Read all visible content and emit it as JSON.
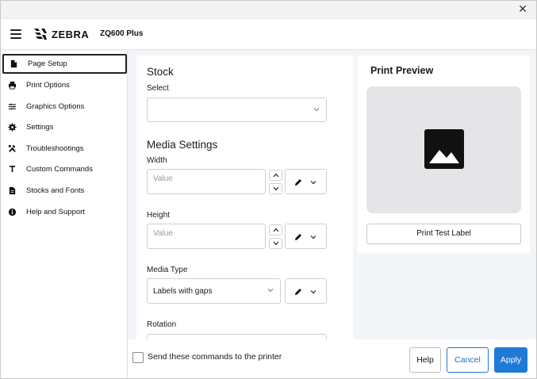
{
  "app": {
    "logo_text": "ZEBRA",
    "device_name": "ZQ600 Plus"
  },
  "sidebar": {
    "items": [
      {
        "label": "Page Setup",
        "icon": "document-icon",
        "active": true
      },
      {
        "label": "Print Options",
        "icon": "printer-icon",
        "active": false
      },
      {
        "label": "Graphics Options",
        "icon": "sliders-icon",
        "active": false
      },
      {
        "label": "Settings",
        "icon": "gear-icon",
        "active": false
      },
      {
        "label": "Troubleshootings",
        "icon": "tools-icon",
        "active": false
      },
      {
        "label": "Custom Commands",
        "icon": "text-t-icon",
        "active": false
      },
      {
        "label": "Stocks and Fonts",
        "icon": "file-icon",
        "active": false
      },
      {
        "label": "Help and Support",
        "icon": "info-icon",
        "active": false
      }
    ]
  },
  "form": {
    "stock": {
      "title": "Stock",
      "select_label": "Select",
      "select_value": ""
    },
    "media": {
      "title": "Media Settings",
      "width_label": "Width",
      "width_placeholder": "Value",
      "height_label": "Height",
      "height_placeholder": "Value",
      "media_type_label": "Media Type",
      "media_type_value": "Labels with gaps",
      "rotation_label": "Rotation"
    }
  },
  "preview": {
    "title": "Print Preview",
    "test_button": "Print Test Label"
  },
  "footer": {
    "send_commands_label": "Send these commands to the printer",
    "send_commands_checked": false,
    "help": "Help",
    "cancel": "Cancel",
    "apply": "Apply"
  },
  "colors": {
    "accent": "#1f7ad6",
    "preview_bg": "#e5e5e8",
    "content_bg": "#f3f5f8"
  }
}
